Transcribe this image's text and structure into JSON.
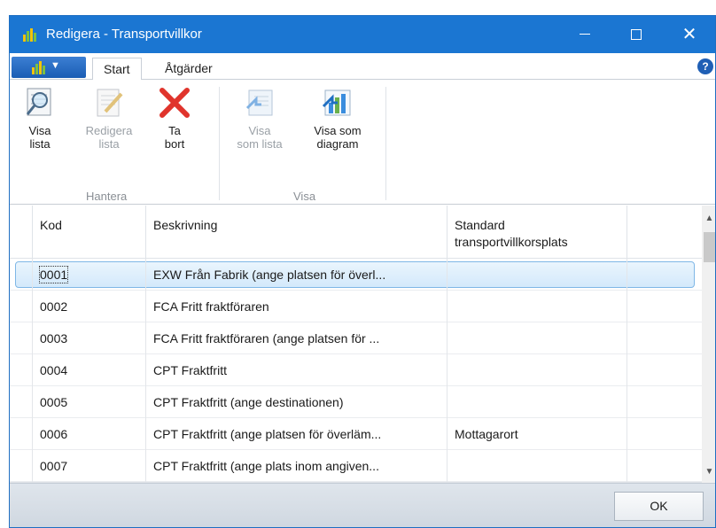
{
  "window": {
    "title": "Redigera - Transportvillkor"
  },
  "titlebar": {
    "minimize_glyph": "",
    "maximize_glyph": "",
    "close_glyph": "✕"
  },
  "tabs": {
    "start": "Start",
    "actions": "Åtgärder"
  },
  "help": {
    "glyph": "?"
  },
  "ribbon": {
    "groups": [
      {
        "label": "Hantera"
      },
      {
        "label": "Visa"
      }
    ],
    "buttons": [
      {
        "line1": "Visa",
        "line2": "lista",
        "icon": "view-list-icon",
        "enabled": true
      },
      {
        "line1": "Redigera",
        "line2": "lista",
        "icon": "edit-list-icon",
        "enabled": false
      },
      {
        "line1": "Ta",
        "line2": "bort",
        "icon": "delete-icon",
        "enabled": true
      },
      {
        "line1": "Visa",
        "line2": "som lista",
        "icon": "view-as-list-icon",
        "enabled": false
      },
      {
        "line1": "Visa som",
        "line2": "diagram",
        "icon": "view-as-chart-icon",
        "enabled": true
      }
    ]
  },
  "grid": {
    "columns": [
      {
        "line1": "Kod",
        "line2": ""
      },
      {
        "line1": "Beskrivning",
        "line2": ""
      },
      {
        "line1": "Standard",
        "line2": "transportvillkorsplats"
      }
    ],
    "rows": [
      {
        "kod": "0001",
        "beskrivning": "EXW Från Fabrik (ange platsen för överl...",
        "standard": "",
        "selected": true
      },
      {
        "kod": "0002",
        "beskrivning": "FCA Fritt fraktföraren",
        "standard": ""
      },
      {
        "kod": "0003",
        "beskrivning": "FCA Fritt fraktföraren (ange platsen för ...",
        "standard": ""
      },
      {
        "kod": "0004",
        "beskrivning": "CPT Fraktfritt",
        "standard": ""
      },
      {
        "kod": "0005",
        "beskrivning": "CPT Fraktfritt (ange destinationen)",
        "standard": ""
      },
      {
        "kod": "0006",
        "beskrivning": "CPT Fraktfritt (ange platsen för överläm...",
        "standard": "Mottagarort"
      },
      {
        "kod": "0007",
        "beskrivning": "CPT Fraktfritt (ange plats inom angiven...",
        "standard": ""
      }
    ]
  },
  "footer": {
    "ok_label": "OK"
  },
  "colors": {
    "titlebar": "#1b76d2",
    "selection": "#d3e9fb",
    "delete": "#e0342c"
  }
}
